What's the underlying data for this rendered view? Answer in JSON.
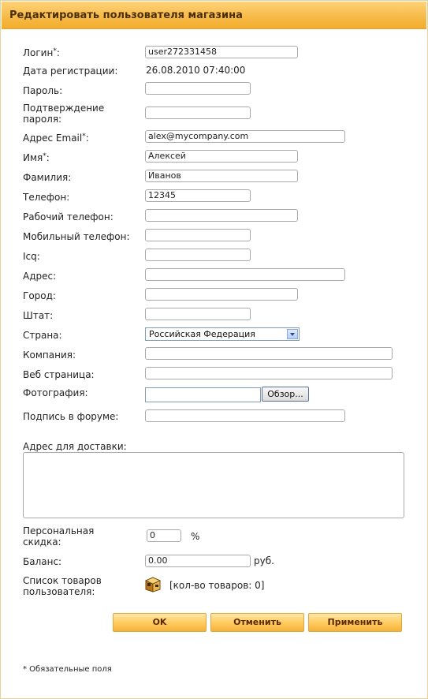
{
  "window": {
    "title": "Редактировать пользователя магазина"
  },
  "form": {
    "login": {
      "label": "Логин",
      "required_mark": "*",
      "colon": ":",
      "value": "user272331458"
    },
    "reg_date": {
      "label": "Дата регистрации:",
      "value": "26.08.2010 07:40:00"
    },
    "password": {
      "label": "Пароль:",
      "value": ""
    },
    "password_confirm": {
      "label_line1": "Подтверждение",
      "label_line2": "пароля:",
      "value": ""
    },
    "email": {
      "label": "Адрес Email",
      "required_mark": "*",
      "colon": ":",
      "value": "alex@mycompany.com"
    },
    "first_name": {
      "label": "Имя",
      "required_mark": "*",
      "colon": ":",
      "value": "Алексей"
    },
    "last_name": {
      "label": "Фамилия:",
      "value": "Иванов"
    },
    "phone": {
      "label": "Телефон:",
      "value": "12345"
    },
    "work_phone": {
      "label": "Рабочий телефон:",
      "value": ""
    },
    "mobile_phone": {
      "label": "Мобильный телефон:",
      "value": ""
    },
    "icq": {
      "label": "Icq:",
      "value": ""
    },
    "address": {
      "label": "Адрес:",
      "value": ""
    },
    "city": {
      "label": "Город:",
      "value": ""
    },
    "state": {
      "label": "Штат:",
      "value": ""
    },
    "country": {
      "label": "Страна:",
      "value": "Российская Федерация"
    },
    "company": {
      "label": "Компания:",
      "value": ""
    },
    "website": {
      "label": "Веб страница:",
      "value": ""
    },
    "photo": {
      "label": "Фотография:",
      "value": "",
      "browse_label": "Обзор..."
    },
    "forum_signature": {
      "label": "Подпись в форуме:",
      "value": ""
    },
    "delivery_address": {
      "label": "Адрес для доставки:",
      "value": ""
    },
    "discount": {
      "label_line1": "Персональная",
      "label_line2": "скидка:",
      "value": "0",
      "unit": "%"
    },
    "balance": {
      "label": "Баланс:",
      "value": "0.00",
      "unit": "руб."
    },
    "products": {
      "label_line1": "Список товаров",
      "label_line2": "пользователя:",
      "count_text": "[кол-во товаров: 0]"
    }
  },
  "buttons": {
    "ok": "OK",
    "cancel": "Отменить",
    "apply": "Применить"
  },
  "footnote": "* Обязательные поля",
  "colors": {
    "title_bar": "#f6b945",
    "button": "#ffc95c"
  }
}
